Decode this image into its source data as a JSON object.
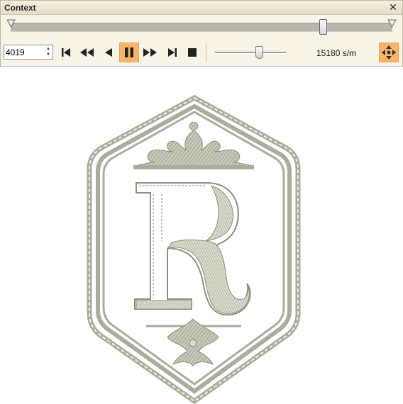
{
  "panel": {
    "title": "Context",
    "close_label": "✕"
  },
  "scrubber": {
    "position_fraction": 0.81
  },
  "playback": {
    "stitch_value": "4019",
    "buttons": [
      "first-stitch",
      "fast-back",
      "step-back",
      "pause",
      "fast-forward",
      "last-stitch",
      "stop"
    ],
    "active_button": "pause"
  },
  "speed": {
    "slider_fraction": 0.62,
    "label": "15180 s/m"
  },
  "design": {
    "monogram_letter": "R",
    "thread_color": "#a9ad9b",
    "accent_color": "#f7b56b"
  }
}
